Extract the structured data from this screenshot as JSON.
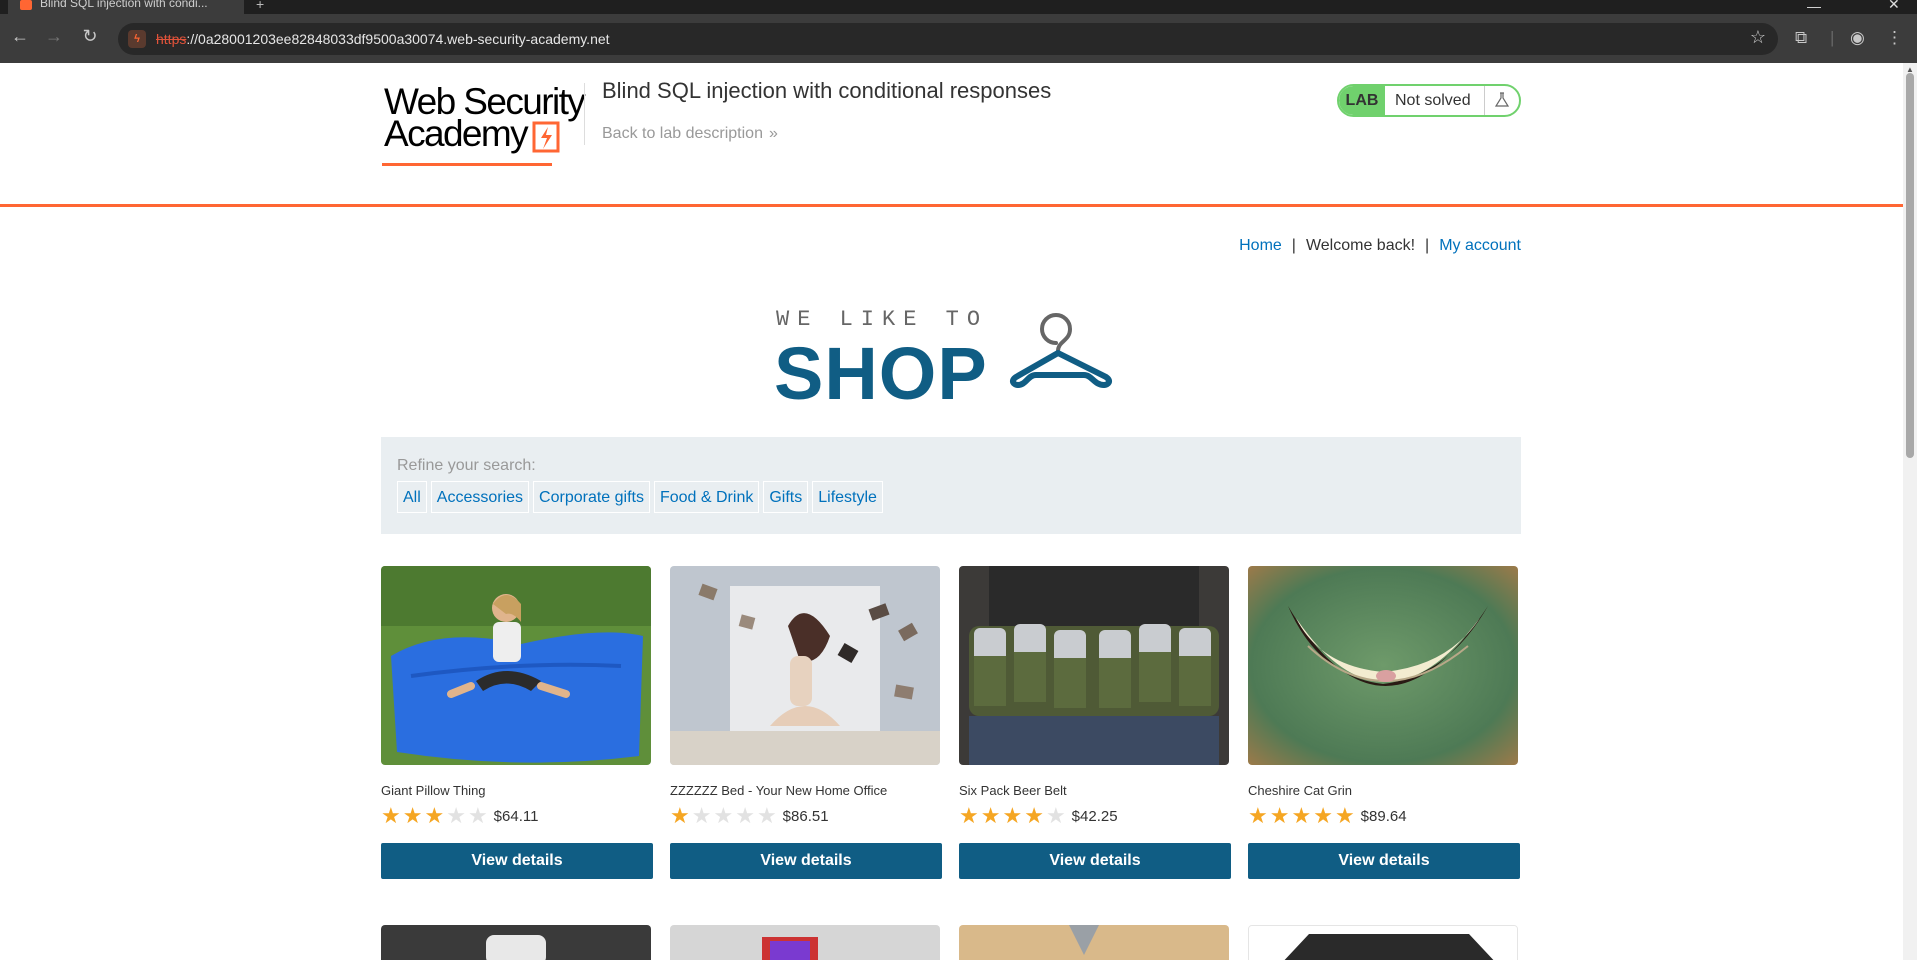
{
  "browser": {
    "tab_title": "Blind SQL injection with condi...",
    "new_tab": "+",
    "url_scheme": "https",
    "url_rest": "://0a28001203ee82848033df9500a30074.web-security-academy.net",
    "site_icon": "ϟ"
  },
  "header": {
    "logo_line1": "Web Security",
    "logo_line2": "Academy",
    "lab_title": "Blind SQL injection with conditional responses",
    "back_link": "Back to lab description",
    "lab_tag": "LAB",
    "lab_status": "Not solved",
    "accent_color": "#ff6633",
    "status_color": "#70d16d"
  },
  "nav": {
    "home": "Home",
    "welcome": "Welcome back!",
    "my_account": "My account",
    "separator": "|"
  },
  "banner": {
    "small_text": "WE LIKE TO",
    "big_text": "SHOP",
    "brand_color": "#105d84"
  },
  "filter": {
    "label": "Refine your search:",
    "categories": [
      "All",
      "Accessories",
      "Corporate gifts",
      "Food & Drink",
      "Gifts",
      "Lifestyle"
    ]
  },
  "products": [
    {
      "name": "Giant Pillow Thing",
      "rating": 3,
      "price": "$64.11",
      "button": "View details"
    },
    {
      "name": "ZZZZZZ Bed - Your New Home Office",
      "rating": 1,
      "price": "$86.51",
      "button": "View details"
    },
    {
      "name": "Six Pack Beer Belt",
      "rating": 4,
      "price": "$42.25",
      "button": "View details"
    },
    {
      "name": "Cheshire Cat Grin",
      "rating": 5,
      "price": "$89.64",
      "button": "View details"
    }
  ]
}
